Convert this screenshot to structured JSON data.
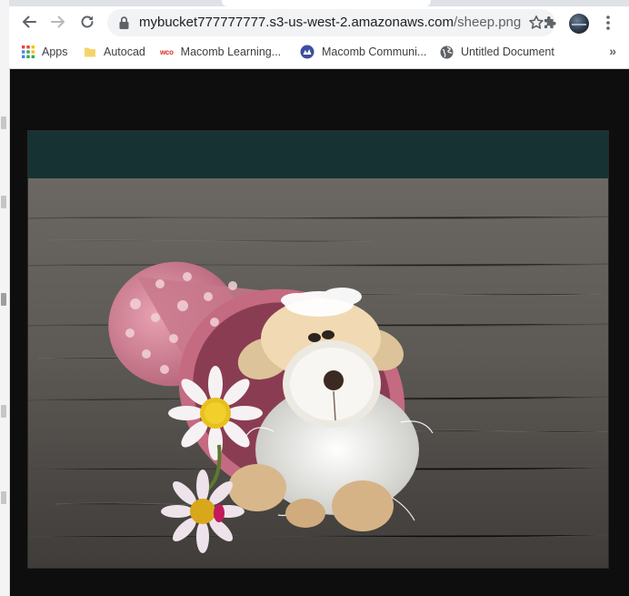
{
  "browser": {
    "url_host": "mybucket777777777.s3-us-west-2.amazonaws.com",
    "url_path": "/sheep.png"
  },
  "bookmarks": [
    {
      "label": "Apps",
      "icon": "apps-grid-icon"
    },
    {
      "label": "Autocad",
      "icon": "folder-icon"
    },
    {
      "label": "Macomb Learning...",
      "icon": "wco-logo-icon",
      "icon_text": "wco"
    },
    {
      "label": "Macomb Communi...",
      "icon": "macomb-logo-icon"
    },
    {
      "label": "Untitled Document",
      "icon": "globe-icon"
    }
  ],
  "colors": {
    "page_background": "#0e0e0e",
    "omnibox": "#f1f3f4",
    "icon": "#5f6368"
  },
  "image": {
    "subject": "sheep-figurine-with-daisies",
    "icon": "photo"
  }
}
